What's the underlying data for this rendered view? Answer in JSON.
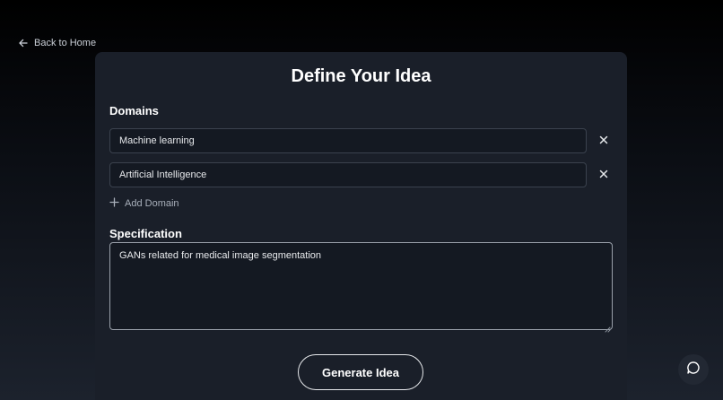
{
  "nav": {
    "back_label": "Back to Home",
    "back_icon": "arrow-left-icon"
  },
  "card": {
    "title": "Define Your Idea",
    "domains": {
      "label": "Domains",
      "items": [
        {
          "value": "Machine learning",
          "remove_icon": "close-icon"
        },
        {
          "value": "Artificial Intelligence",
          "remove_icon": "close-icon"
        }
      ],
      "add_label": "Add Domain",
      "add_icon": "plus-icon"
    },
    "specification": {
      "label": "Specification",
      "value": "GANs related for medical image segmentation"
    },
    "generate_label": "Generate Idea"
  },
  "chat": {
    "icon": "chat-bubble-icon"
  },
  "colors": {
    "card_bg": "#1a1f29",
    "input_bg": "#141922",
    "input_border": "#3b424e",
    "focused_border": "#9aa1ab",
    "text_primary": "#ffffff",
    "text_muted": "#a8afba"
  }
}
